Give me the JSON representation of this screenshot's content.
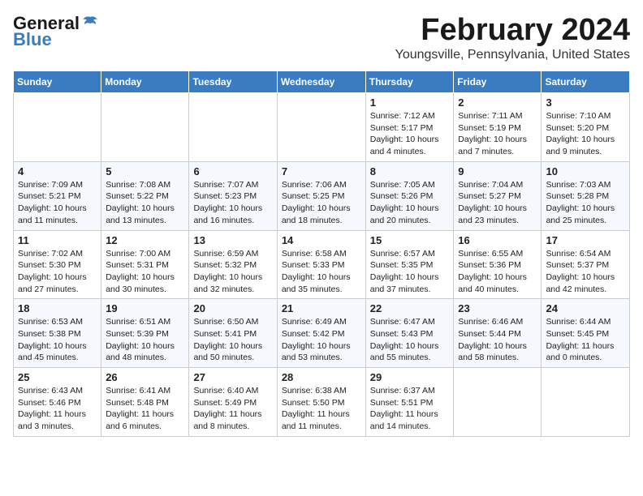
{
  "logo": {
    "general": "General",
    "blue": "Blue"
  },
  "header": {
    "month": "February 2024",
    "location": "Youngsville, Pennsylvania, United States"
  },
  "weekdays": [
    "Sunday",
    "Monday",
    "Tuesday",
    "Wednesday",
    "Thursday",
    "Friday",
    "Saturday"
  ],
  "weeks": [
    [
      {
        "day": "",
        "info": ""
      },
      {
        "day": "",
        "info": ""
      },
      {
        "day": "",
        "info": ""
      },
      {
        "day": "",
        "info": ""
      },
      {
        "day": "1",
        "info": "Sunrise: 7:12 AM\nSunset: 5:17 PM\nDaylight: 10 hours\nand 4 minutes."
      },
      {
        "day": "2",
        "info": "Sunrise: 7:11 AM\nSunset: 5:19 PM\nDaylight: 10 hours\nand 7 minutes."
      },
      {
        "day": "3",
        "info": "Sunrise: 7:10 AM\nSunset: 5:20 PM\nDaylight: 10 hours\nand 9 minutes."
      }
    ],
    [
      {
        "day": "4",
        "info": "Sunrise: 7:09 AM\nSunset: 5:21 PM\nDaylight: 10 hours\nand 11 minutes."
      },
      {
        "day": "5",
        "info": "Sunrise: 7:08 AM\nSunset: 5:22 PM\nDaylight: 10 hours\nand 13 minutes."
      },
      {
        "day": "6",
        "info": "Sunrise: 7:07 AM\nSunset: 5:23 PM\nDaylight: 10 hours\nand 16 minutes."
      },
      {
        "day": "7",
        "info": "Sunrise: 7:06 AM\nSunset: 5:25 PM\nDaylight: 10 hours\nand 18 minutes."
      },
      {
        "day": "8",
        "info": "Sunrise: 7:05 AM\nSunset: 5:26 PM\nDaylight: 10 hours\nand 20 minutes."
      },
      {
        "day": "9",
        "info": "Sunrise: 7:04 AM\nSunset: 5:27 PM\nDaylight: 10 hours\nand 23 minutes."
      },
      {
        "day": "10",
        "info": "Sunrise: 7:03 AM\nSunset: 5:28 PM\nDaylight: 10 hours\nand 25 minutes."
      }
    ],
    [
      {
        "day": "11",
        "info": "Sunrise: 7:02 AM\nSunset: 5:30 PM\nDaylight: 10 hours\nand 27 minutes."
      },
      {
        "day": "12",
        "info": "Sunrise: 7:00 AM\nSunset: 5:31 PM\nDaylight: 10 hours\nand 30 minutes."
      },
      {
        "day": "13",
        "info": "Sunrise: 6:59 AM\nSunset: 5:32 PM\nDaylight: 10 hours\nand 32 minutes."
      },
      {
        "day": "14",
        "info": "Sunrise: 6:58 AM\nSunset: 5:33 PM\nDaylight: 10 hours\nand 35 minutes."
      },
      {
        "day": "15",
        "info": "Sunrise: 6:57 AM\nSunset: 5:35 PM\nDaylight: 10 hours\nand 37 minutes."
      },
      {
        "day": "16",
        "info": "Sunrise: 6:55 AM\nSunset: 5:36 PM\nDaylight: 10 hours\nand 40 minutes."
      },
      {
        "day": "17",
        "info": "Sunrise: 6:54 AM\nSunset: 5:37 PM\nDaylight: 10 hours\nand 42 minutes."
      }
    ],
    [
      {
        "day": "18",
        "info": "Sunrise: 6:53 AM\nSunset: 5:38 PM\nDaylight: 10 hours\nand 45 minutes."
      },
      {
        "day": "19",
        "info": "Sunrise: 6:51 AM\nSunset: 5:39 PM\nDaylight: 10 hours\nand 48 minutes."
      },
      {
        "day": "20",
        "info": "Sunrise: 6:50 AM\nSunset: 5:41 PM\nDaylight: 10 hours\nand 50 minutes."
      },
      {
        "day": "21",
        "info": "Sunrise: 6:49 AM\nSunset: 5:42 PM\nDaylight: 10 hours\nand 53 minutes."
      },
      {
        "day": "22",
        "info": "Sunrise: 6:47 AM\nSunset: 5:43 PM\nDaylight: 10 hours\nand 55 minutes."
      },
      {
        "day": "23",
        "info": "Sunrise: 6:46 AM\nSunset: 5:44 PM\nDaylight: 10 hours\nand 58 minutes."
      },
      {
        "day": "24",
        "info": "Sunrise: 6:44 AM\nSunset: 5:45 PM\nDaylight: 11 hours\nand 0 minutes."
      }
    ],
    [
      {
        "day": "25",
        "info": "Sunrise: 6:43 AM\nSunset: 5:46 PM\nDaylight: 11 hours\nand 3 minutes."
      },
      {
        "day": "26",
        "info": "Sunrise: 6:41 AM\nSunset: 5:48 PM\nDaylight: 11 hours\nand 6 minutes."
      },
      {
        "day": "27",
        "info": "Sunrise: 6:40 AM\nSunset: 5:49 PM\nDaylight: 11 hours\nand 8 minutes."
      },
      {
        "day": "28",
        "info": "Sunrise: 6:38 AM\nSunset: 5:50 PM\nDaylight: 11 hours\nand 11 minutes."
      },
      {
        "day": "29",
        "info": "Sunrise: 6:37 AM\nSunset: 5:51 PM\nDaylight: 11 hours\nand 14 minutes."
      },
      {
        "day": "",
        "info": ""
      },
      {
        "day": "",
        "info": ""
      }
    ]
  ]
}
